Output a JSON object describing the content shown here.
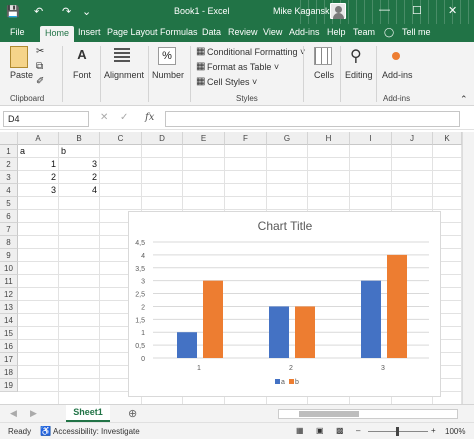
{
  "titlebar": {
    "save_icon": "💾",
    "undo_icon": "↶",
    "redo_icon": "↷",
    "custom_icon": "⌄",
    "doc_title": "Book1  -  Excel",
    "user_name": "Mike Kaganski",
    "min": "—",
    "max": "☐",
    "close": "✕",
    "color": "#217346"
  },
  "tabs": [
    "File",
    "Home",
    "Insert",
    "Page Layout",
    "Formulas",
    "Data",
    "Review",
    "View",
    "Add-ins",
    "Help",
    "Team",
    "Tell me"
  ],
  "ribbon": {
    "paste_label": "Paste",
    "clipboard_label": "Clipboard",
    "font_label": "Font",
    "alignment_label": "Alignment",
    "number_label": "Number",
    "cond_format": "Conditional Formatting ˅",
    "format_table": "Format as Table ˅",
    "cell_styles": "Cell Styles ˅",
    "styles_label": "Styles",
    "cells_label": "Cells",
    "editing_label": "Editing",
    "addins_label": "Add-ins",
    "addins_group": "Add-ins"
  },
  "formula_bar": {
    "name_box": "D4",
    "fx": "fx",
    "cancel": "✕",
    "enter": "✓",
    "formula": ""
  },
  "grid": {
    "columns": [
      "A",
      "B",
      "C",
      "D",
      "E",
      "F",
      "G",
      "H",
      "I",
      "J",
      "K"
    ],
    "rows": [
      "1",
      "2",
      "3",
      "4",
      "5",
      "6",
      "7",
      "8",
      "9",
      "10",
      "11",
      "12",
      "13",
      "14",
      "15",
      "16",
      "17",
      "18",
      "19"
    ],
    "cells": {
      "A1": "a",
      "B1": "b",
      "A2": "1",
      "B2": "3",
      "A3": "2",
      "B3": "2",
      "A4": "3",
      "B4": "4"
    }
  },
  "chart_data": {
    "type": "bar",
    "title": "Chart Title",
    "categories": [
      "1",
      "2",
      "3"
    ],
    "series": [
      {
        "name": "a",
        "values": [
          1,
          2,
          3
        ],
        "color": "#4472c4"
      },
      {
        "name": "b",
        "values": [
          3,
          2,
          4
        ],
        "color": "#ed7d31"
      }
    ],
    "y_ticks": [
      "0",
      "0,5",
      "1",
      "1,5",
      "2",
      "2,5",
      "3",
      "3,5",
      "4",
      "4,5"
    ],
    "ylim": [
      0,
      4.5
    ],
    "grid": true,
    "legend_position": "bottom"
  },
  "sheets": {
    "active": "Sheet1",
    "add": "⊕"
  },
  "status": {
    "ready": "Ready",
    "accessibility": "Accessibility: Investigate",
    "zoom": "100%"
  }
}
